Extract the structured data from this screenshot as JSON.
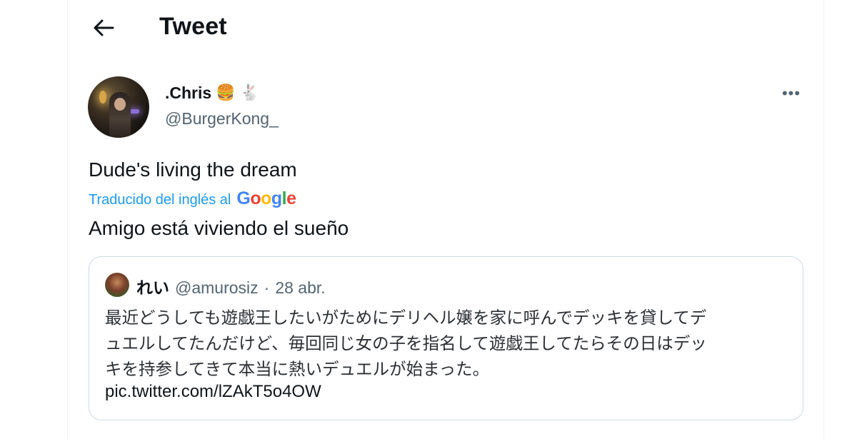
{
  "header": {
    "title": "Tweet"
  },
  "tweet": {
    "display_name": ".Chris",
    "name_emojis": [
      "🍔",
      "🐇"
    ],
    "handle": "@BurgerKong_",
    "more_label": "•••",
    "text": "Dude's living the dream",
    "translation": {
      "label": "Traducido del inglés al",
      "provider": "Google",
      "text": "Amigo está viviendo el sueño"
    }
  },
  "quote": {
    "name": "れい",
    "handle": "@amurosiz",
    "separator": "·",
    "date": "28 abr.",
    "lines": [
      "最近どうしても遊戯王したいがためにデリヘル嬢を家に呼んでデッキを貸してデ",
      "ュエルしてたんだけど、毎回同じ女の子を指名して遊戯王してたらその日はデッ",
      "キを持参してきて本当に熱いデュエルが始まった。"
    ],
    "link": "pic.twitter.com/lZAkT5o4OW"
  },
  "colors": {
    "accent": "#1d9bf0",
    "secondary_text": "#536471",
    "border": "#cfd9de",
    "google_blue": "#4285f4",
    "google_red": "#ea4335",
    "google_yellow": "#fbbc05",
    "google_green": "#34a853"
  }
}
